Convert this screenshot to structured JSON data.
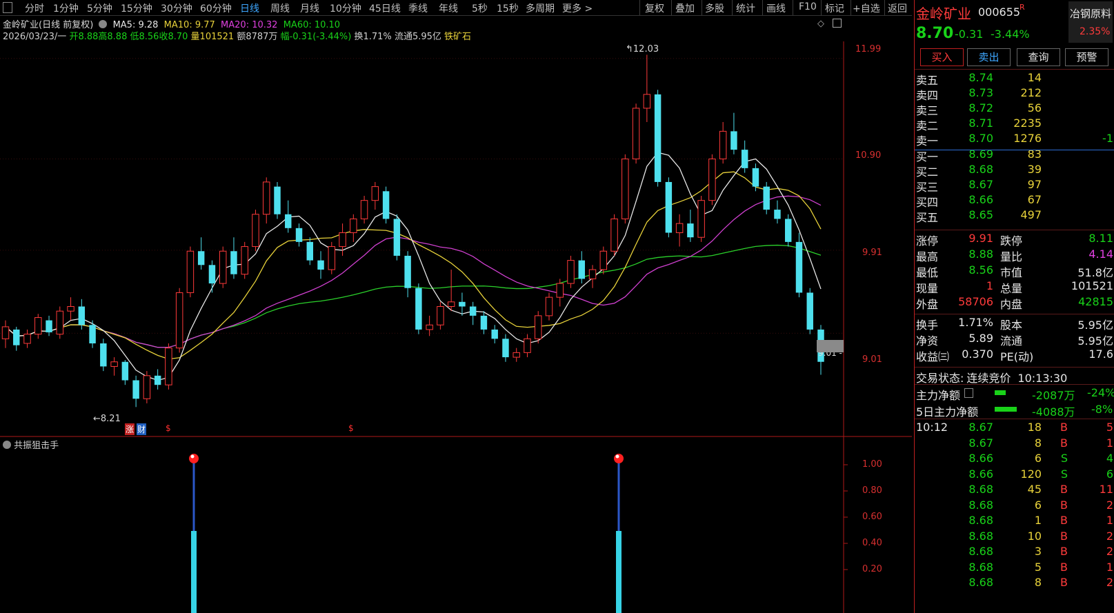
{
  "toolbar": {
    "periods": [
      "分时",
      "1分钟",
      "5分钟",
      "15分钟",
      "30分钟",
      "60分钟",
      "日线",
      "周线",
      "月线",
      "10分钟",
      "45日线",
      "季线",
      "年线",
      "5秒",
      "15秒",
      "多周期",
      "更多 >"
    ],
    "active_period": "日线",
    "tools": [
      "复权",
      "叠加",
      "多股",
      "统计",
      "画线",
      "F10",
      "标记",
      "+自选",
      "返回"
    ]
  },
  "chart": {
    "title": "金岭矿业(日线 前复权)",
    "ma5": "MA5: 9.28",
    "ma10": "MA10: 9.77",
    "ma20": "MA20: 10.32",
    "ma60": "MA60: 10.10",
    "date": "2026/03/23/一",
    "open": "开8.88",
    "high": "高8.88",
    "low": "低8.56",
    "close": "收8.70",
    "volume": "量101521",
    "amount": "额8787万",
    "change": "幅-0.31(-3.44%)",
    "turnover": "换1.71%",
    "float": "流通5.95亿",
    "concept": "铁矿石",
    "y_ticks": [
      "11.99",
      "10.90",
      "9.91",
      "9.01"
    ],
    "high_mark": "12.03",
    "low_mark": "8.21",
    "last_mark": "9.01",
    "tags": [
      "涨",
      "财",
      "$",
      "$"
    ]
  },
  "indicator": {
    "title": "共振狙击手",
    "y_ticks": [
      "1.00",
      "0.80",
      "0.60",
      "0.40",
      "0.20"
    ]
  },
  "chart_data": {
    "type": "candlestick",
    "title": "金岭矿业(日线 前复权)",
    "ylim": [
      8.1,
      12.1
    ],
    "candles": [
      [
        8.95,
        9.15,
        8.85,
        9.08
      ],
      [
        9.05,
        9.08,
        8.82,
        8.88
      ],
      [
        8.9,
        9.05,
        8.85,
        9.0
      ],
      [
        9.0,
        9.22,
        8.95,
        9.18
      ],
      [
        9.15,
        9.2,
        8.98,
        9.02
      ],
      [
        9.0,
        9.3,
        8.95,
        9.25
      ],
      [
        9.25,
        9.4,
        9.15,
        9.3
      ],
      [
        9.3,
        9.38,
        9.05,
        9.1
      ],
      [
        9.1,
        9.15,
        8.85,
        8.9
      ],
      [
        8.9,
        8.95,
        8.6,
        8.65
      ],
      [
        8.65,
        8.75,
        8.55,
        8.7
      ],
      [
        8.7,
        8.72,
        8.45,
        8.5
      ],
      [
        8.5,
        8.55,
        8.21,
        8.3
      ],
      [
        8.3,
        8.6,
        8.25,
        8.55
      ],
      [
        8.55,
        8.62,
        8.4,
        8.45
      ],
      [
        8.45,
        8.9,
        8.4,
        8.85
      ],
      [
        8.85,
        9.5,
        8.8,
        9.45
      ],
      [
        9.45,
        9.95,
        9.4,
        9.9
      ],
      [
        9.9,
        10.05,
        9.7,
        9.75
      ],
      [
        9.75,
        9.8,
        9.45,
        9.55
      ],
      [
        9.55,
        9.95,
        9.5,
        9.9
      ],
      [
        9.9,
        10.05,
        9.6,
        9.65
      ],
      [
        9.65,
        10.0,
        9.6,
        9.95
      ],
      [
        9.95,
        10.35,
        9.9,
        10.3
      ],
      [
        10.3,
        10.7,
        10.2,
        10.65
      ],
      [
        10.6,
        10.65,
        10.25,
        10.3
      ],
      [
        10.3,
        10.45,
        10.1,
        10.15
      ],
      [
        10.15,
        10.2,
        9.95,
        10.0
      ],
      [
        10.0,
        10.05,
        9.75,
        9.8
      ],
      [
        9.8,
        9.9,
        9.6,
        9.7
      ],
      [
        9.7,
        10.0,
        9.65,
        9.95
      ],
      [
        9.95,
        10.2,
        9.85,
        10.1
      ],
      [
        10.1,
        10.3,
        10.0,
        10.25
      ],
      [
        10.25,
        10.5,
        10.2,
        10.45
      ],
      [
        10.45,
        10.65,
        10.35,
        10.6
      ],
      [
        10.55,
        10.6,
        10.2,
        10.25
      ],
      [
        10.25,
        10.3,
        9.8,
        9.85
      ],
      [
        9.85,
        9.9,
        9.4,
        9.5
      ],
      [
        9.5,
        9.55,
        9.0,
        9.05
      ],
      [
        9.05,
        9.2,
        8.98,
        9.1
      ],
      [
        9.1,
        9.35,
        9.05,
        9.3
      ],
      [
        9.3,
        9.7,
        9.25,
        9.35
      ],
      [
        9.35,
        9.45,
        9.2,
        9.3
      ],
      [
        9.3,
        9.35,
        9.1,
        9.2
      ],
      [
        9.2,
        9.25,
        9.0,
        9.05
      ],
      [
        9.05,
        9.1,
        8.9,
        8.95
      ],
      [
        8.95,
        9.0,
        8.7,
        8.75
      ],
      [
        8.75,
        8.85,
        8.7,
        8.8
      ],
      [
        8.8,
        9.0,
        8.75,
        8.95
      ],
      [
        8.95,
        9.25,
        8.9,
        9.2
      ],
      [
        9.2,
        9.45,
        9.15,
        9.4
      ],
      [
        9.4,
        9.6,
        9.3,
        9.55
      ],
      [
        9.55,
        9.85,
        9.5,
        9.8
      ],
      [
        9.8,
        9.9,
        9.55,
        9.6
      ],
      [
        9.6,
        9.75,
        9.5,
        9.7
      ],
      [
        9.7,
        9.95,
        9.65,
        9.9
      ],
      [
        9.9,
        10.3,
        9.85,
        10.25
      ],
      [
        10.25,
        10.95,
        10.2,
        10.9
      ],
      [
        10.9,
        11.5,
        10.85,
        11.45
      ],
      [
        11.45,
        12.03,
        11.3,
        11.6
      ],
      [
        11.6,
        11.65,
        10.6,
        10.65
      ],
      [
        10.65,
        10.7,
        10.05,
        10.1
      ],
      [
        10.1,
        10.3,
        9.95,
        10.2
      ],
      [
        10.2,
        10.35,
        10.0,
        10.05
      ],
      [
        10.05,
        10.5,
        10.0,
        10.45
      ],
      [
        10.45,
        10.95,
        10.4,
        10.9
      ],
      [
        10.9,
        11.3,
        10.85,
        11.2
      ],
      [
        11.2,
        11.4,
        10.95,
        11.0
      ],
      [
        11.0,
        11.1,
        10.75,
        10.8
      ],
      [
        10.8,
        10.85,
        10.55,
        10.6
      ],
      [
        10.6,
        10.65,
        10.3,
        10.35
      ],
      [
        10.35,
        10.45,
        10.2,
        10.25
      ],
      [
        10.25,
        10.3,
        9.95,
        10.0
      ],
      [
        10.0,
        10.1,
        9.4,
        9.45
      ],
      [
        9.45,
        9.5,
        9.0,
        9.05
      ],
      [
        9.05,
        9.1,
        8.56,
        8.7
      ]
    ]
  },
  "panel": {
    "name": "金岭矿业",
    "code": "000655",
    "r_mark": "R",
    "sector": "冶钢原料",
    "sector_pct": "2.35%",
    "price": "8.70",
    "chg": "-0.31",
    "pct": "-3.44%",
    "buttons": [
      "买入",
      "卖出",
      "查询",
      "预警"
    ],
    "asks": [
      {
        "label": "卖五",
        "price": "8.74",
        "vol": "14"
      },
      {
        "label": "卖四",
        "price": "8.73",
        "vol": "212"
      },
      {
        "label": "卖三",
        "price": "8.72",
        "vol": "56"
      },
      {
        "label": "卖二",
        "price": "8.71",
        "vol": "2235"
      },
      {
        "label": "卖一",
        "price": "8.70",
        "vol": "1276",
        "extra": "-1"
      }
    ],
    "bids": [
      {
        "label": "买一",
        "price": "8.69",
        "vol": "83"
      },
      {
        "label": "买二",
        "price": "8.68",
        "vol": "39"
      },
      {
        "label": "买三",
        "price": "8.67",
        "vol": "97"
      },
      {
        "label": "买四",
        "price": "8.66",
        "vol": "67"
      },
      {
        "label": "买五",
        "price": "8.65",
        "vol": "497"
      }
    ],
    "stats": [
      {
        "l1": "涨停",
        "v1": "9.91",
        "c1": "red",
        "l2": "跌停",
        "v2": "8.11",
        "c2": "green"
      },
      {
        "l1": "最高",
        "v1": "8.88",
        "c1": "green",
        "l2": "量比",
        "v2": "4.14",
        "c2": "mag"
      },
      {
        "l1": "最低",
        "v1": "8.56",
        "c1": "green",
        "l2": "市值",
        "v2": "51.8亿",
        "c2": "wht"
      },
      {
        "l1": "现量",
        "v1": "1",
        "c1": "red",
        "l2": "总量",
        "v2": "101521",
        "c2": "wht"
      },
      {
        "l1": "外盘",
        "v1": "58706",
        "c1": "red",
        "l2": "内盘",
        "v2": "42815",
        "c2": "green"
      }
    ],
    "fin": [
      {
        "l1": "换手",
        "v1": "1.71%",
        "l2": "股本",
        "v2": "5.95亿"
      },
      {
        "l1": "净资",
        "v1": "5.89",
        "l2": "流通",
        "v2": "5.95亿"
      },
      {
        "l1": "收益㈢",
        "v1": "0.370",
        "l2": "PE(动)",
        "v2": "17.6"
      }
    ],
    "trade_state_label": "交易状态:",
    "trade_state": "连续竞价",
    "trade_time": "10:13:30",
    "main_net_label": "主力净额",
    "main_net": "-2087万",
    "main_net_pct": "-24%",
    "main5_label": "5日主力净额",
    "main5": "-4088万",
    "main5_pct": "-8%",
    "ticks": [
      {
        "t": "10:12",
        "p": "8.67",
        "v": "18",
        "s": "B",
        "n": "5"
      },
      {
        "t": "",
        "p": "8.67",
        "v": "8",
        "s": "B",
        "n": "1"
      },
      {
        "t": "",
        "p": "8.66",
        "v": "6",
        "s": "S",
        "n": "4"
      },
      {
        "t": "",
        "p": "8.66",
        "v": "120",
        "s": "S",
        "n": "6"
      },
      {
        "t": "",
        "p": "8.68",
        "v": "45",
        "s": "B",
        "n": "11"
      },
      {
        "t": "",
        "p": "8.68",
        "v": "6",
        "s": "B",
        "n": "2"
      },
      {
        "t": "",
        "p": "8.68",
        "v": "1",
        "s": "B",
        "n": "1"
      },
      {
        "t": "",
        "p": "8.68",
        "v": "10",
        "s": "B",
        "n": "2"
      },
      {
        "t": "",
        "p": "8.68",
        "v": "3",
        "s": "B",
        "n": "2"
      },
      {
        "t": "",
        "p": "8.68",
        "v": "5",
        "s": "B",
        "n": "1"
      },
      {
        "t": "",
        "p": "8.68",
        "v": "8",
        "s": "B",
        "n": "2"
      }
    ]
  }
}
